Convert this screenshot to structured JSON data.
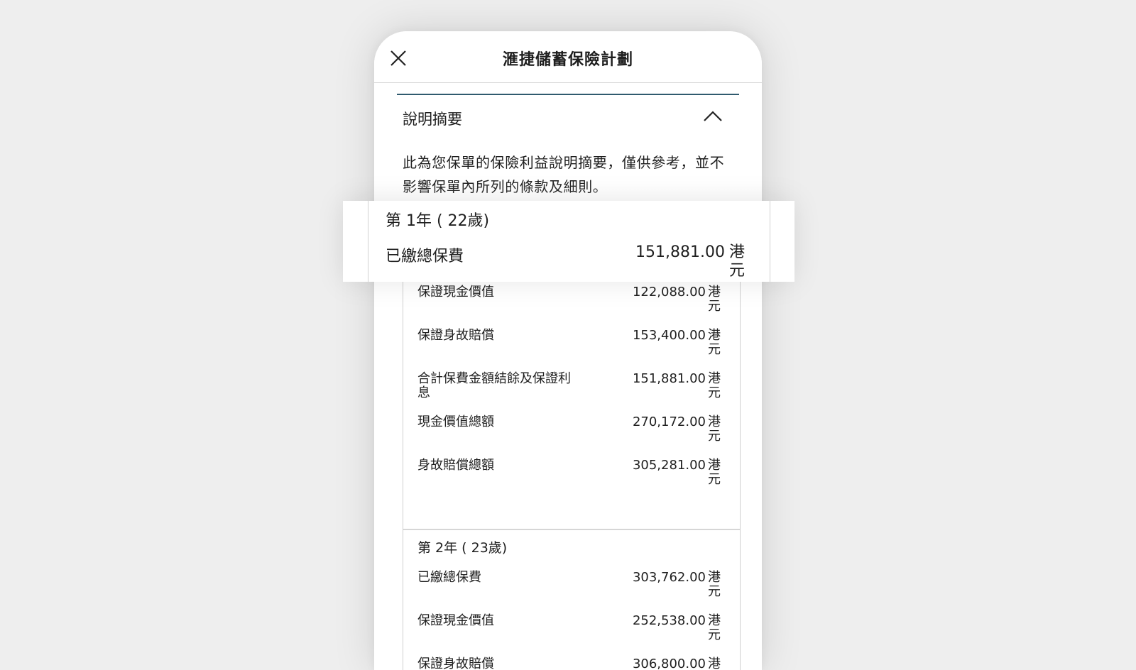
{
  "header": {
    "title": "滙捷儲蓄保險計劃",
    "close_icon": "close-icon"
  },
  "summary": {
    "title": "說明摘要",
    "toggle_icon": "chevron-up-icon",
    "description": "此為您保單的保險利益說明摘要，僅供參考，並不影響保單內所列的條款及細則。"
  },
  "currency": "港元",
  "year1": {
    "title": "第 1年 ( 22歲)",
    "rows": [
      {
        "label": "已繳總保費",
        "value": "151,881.00"
      },
      {
        "label": "保證現金價值",
        "value": "122,088.00"
      },
      {
        "label": "保證身故賠償",
        "value": "153,400.00"
      },
      {
        "label": "合計保費金額結餘及保證利息",
        "value": "151,881.00"
      },
      {
        "label": "現金價值總額",
        "value": "270,172.00"
      },
      {
        "label": "身故賠償總額",
        "value": "305,281.00"
      }
    ]
  },
  "year2": {
    "title": "第 2年 ( 23歲)",
    "rows": [
      {
        "label": "已繳總保費",
        "value": "303,762.00"
      },
      {
        "label": "保證現金價值",
        "value": "252,538.00"
      },
      {
        "label": "保證身故賠償",
        "value": "306,800.00"
      }
    ]
  },
  "colors": {
    "accent_line": "#305a6e",
    "background": "#eeeeee"
  }
}
